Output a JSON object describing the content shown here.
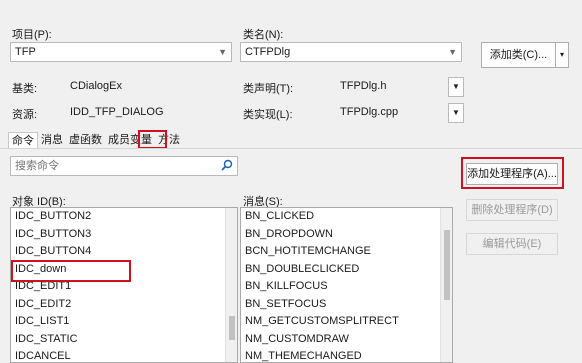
{
  "project": {
    "label": "项目(P):",
    "value": "TFP"
  },
  "classname": {
    "label": "类名(N):",
    "value": "CTFPDlg"
  },
  "add_class_button": "添加类(C)...",
  "add_class_dropdown_glyph": "▾",
  "base_class": {
    "label": "基类:",
    "value": "CDialogEx"
  },
  "class_declaration": {
    "label": "类声明(T):",
    "value": "TFPDlg.h"
  },
  "resource": {
    "label": "资源:",
    "value": "IDD_TFP_DIALOG"
  },
  "class_implementation": {
    "label": "类实现(L):",
    "value": "TFPDlg.cpp"
  },
  "tabs": [
    "命令",
    "消息",
    "虚函数",
    "成员变量",
    "方法"
  ],
  "search": {
    "placeholder": "搜索命令"
  },
  "object_ids": {
    "label": "对象 ID(B):",
    "items": [
      "IDC_BUTTON2",
      "IDC_BUTTON3",
      "IDC_BUTTON4",
      "IDC_down",
      "IDC_EDIT1",
      "IDC_EDIT2",
      "IDC_LIST1",
      "IDC_STATIC",
      "IDCANCEL"
    ]
  },
  "messages": {
    "label": "消息(S):",
    "items": [
      "BN_CLICKED",
      "BN_DROPDOWN",
      "BCN_HOTITEMCHANGE",
      "BN_DOUBLECLICKED",
      "BN_KILLFOCUS",
      "BN_SETFOCUS",
      "NM_GETCUSTOMSPLITRECT",
      "NM_CUSTOMDRAW",
      "NM_THEMECHANGED"
    ]
  },
  "buttons": {
    "add_handler": "添加处理程序(A)...",
    "delete_handler": "删除处理程序(D)",
    "edit_code": "编辑代码(E)"
  },
  "colors": {
    "highlight_box": "#d0101e",
    "disabled_text": "#9a9a9a"
  }
}
